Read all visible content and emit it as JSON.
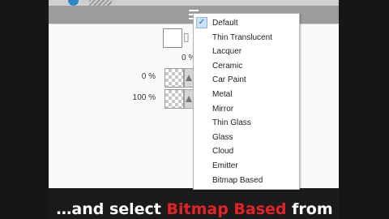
{
  "menu": {
    "items": [
      "Default",
      "Thin Translucent",
      "Lacquer",
      "Ceramic",
      "Car Paint",
      "Metal",
      "Mirror",
      "Thin Glass",
      "Glass",
      "Cloud",
      "Emitter",
      "Bitmap Based"
    ],
    "selected": "Default",
    "check_glyph": "✓"
  },
  "panel": {
    "zero_value": "0 %",
    "rows": [
      {
        "label": "0 %"
      },
      {
        "label": "100 %"
      }
    ]
  },
  "caption": {
    "prefix": "…and select ",
    "highlight": "Bitmap Based",
    "suffix": " from"
  },
  "colors": {
    "highlight": "#e3232a",
    "accent": "#2f86c8"
  },
  "icons": [
    "menu-icon",
    "checker-pattern-icon",
    "triangle-icon"
  ]
}
